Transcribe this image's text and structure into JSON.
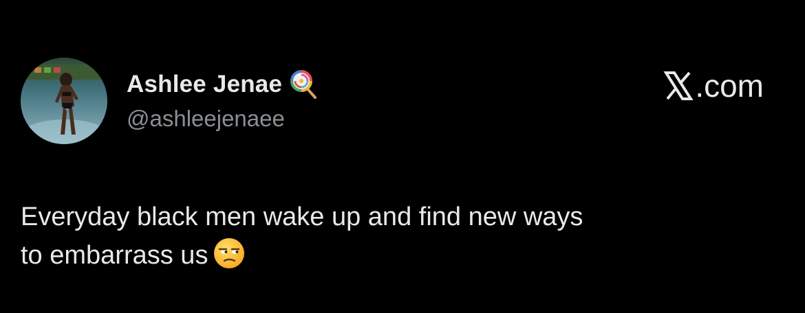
{
  "author": {
    "display_name": "Ashlee Jenae",
    "handle": "@ashleejenaee",
    "badge_icon": "lollipop-icon",
    "avatar": "profile-photo"
  },
  "brand": {
    "label": ".com",
    "logo_icon": "x-logo-icon"
  },
  "tweet": {
    "line1": "Everyday black men wake up and find new ways",
    "line2": "to embarrass us",
    "emoji_icon": "unamused-face-icon"
  },
  "colors": {
    "background": "#000000",
    "primary_text": "#e7e9ea",
    "secondary_text": "#8b8f93"
  }
}
